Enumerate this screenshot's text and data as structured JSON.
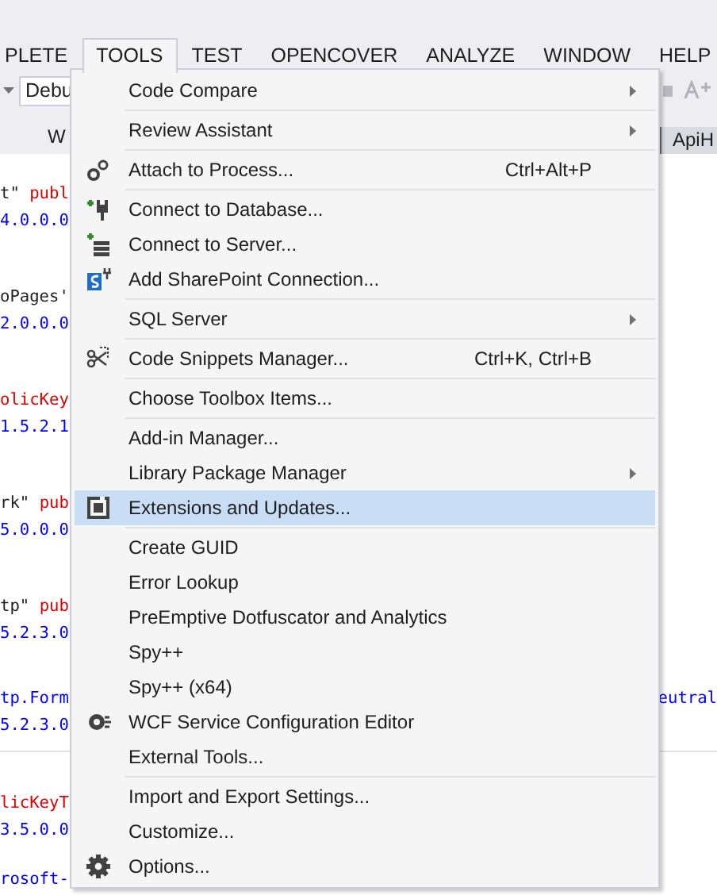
{
  "menu_bar": [
    {
      "label": "PLETE",
      "selected": false
    },
    {
      "label": "TOOLS",
      "selected": true
    },
    {
      "label": "TEST",
      "selected": false
    },
    {
      "label": "OPENCOVER",
      "selected": false
    },
    {
      "label": "ANALYZE",
      "selected": false
    },
    {
      "label": "WINDOW",
      "selected": false
    },
    {
      "label": "HELP",
      "selected": false
    }
  ],
  "toolbar": {
    "config_dropdown": "Debu"
  },
  "tabs": [
    {
      "label": "W",
      "selected": false
    },
    {
      "label": "ApiH",
      "selected": true
    }
  ],
  "code": [
    [
      [
        {
          "text": "t\" ",
          "kind": "plain"
        },
        {
          "text": "publ",
          "kind": "attr"
        }
      ],
      [
        {
          "text": "4.0.0.0",
          "kind": "value"
        }
      ]
    ],
    [
      [
        {
          "text": "oPages'",
          "kind": "plain"
        }
      ],
      [
        {
          "text": "2.0.0.0",
          "kind": "value"
        }
      ]
    ],
    [
      [
        {
          "text": "olicKey",
          "kind": "attr"
        }
      ],
      [
        {
          "text": "1.5.2.1",
          "kind": "value"
        }
      ]
    ],
    [
      [
        {
          "text": "rk\" ",
          "kind": "plain"
        },
        {
          "text": "pub",
          "kind": "attr"
        }
      ],
      [
        {
          "text": "5.0.0.0",
          "kind": "value"
        }
      ]
    ],
    [
      [
        {
          "text": "tp\" ",
          "kind": "plain"
        },
        {
          "text": "pub",
          "kind": "attr"
        }
      ],
      [
        {
          "text": "5.2.3.0",
          "kind": "value"
        }
      ]
    ],
    [
      [
        {
          "text": "tp.Form",
          "kind": "value"
        },
        {
          "text": "eutral",
          "kind": "value_right"
        }
      ],
      [
        {
          "text": "5.2.3.0",
          "kind": "value"
        }
      ]
    ],
    [
      [
        {
          "text": "licKeyT",
          "kind": "attr"
        }
      ],
      [
        {
          "text": "3.5.0.0",
          "kind": "value"
        }
      ]
    ],
    [
      [
        {
          "text": "rosoft-",
          "kind": "value"
        }
      ]
    ]
  ],
  "tools_menu": [
    [
      {
        "label": "Code Compare",
        "submenu": true,
        "selected": false
      }
    ],
    [
      {
        "label": "Review Assistant",
        "submenu": true,
        "selected": false
      }
    ],
    [
      {
        "label": "Attach to Process...",
        "shortcut": "Ctrl+Alt+P",
        "submenu": false,
        "selected": false
      }
    ],
    [
      {
        "label": "Connect to Database...",
        "submenu": false,
        "selected": false
      },
      {
        "label": "Connect to Server...",
        "submenu": false,
        "selected": false
      },
      {
        "label": "Add SharePoint Connection...",
        "submenu": false,
        "selected": false
      }
    ],
    [
      {
        "label": "SQL Server",
        "submenu": true,
        "selected": false
      }
    ],
    [
      {
        "label": "Code Snippets Manager...",
        "shortcut": "Ctrl+K, Ctrl+B",
        "submenu": false,
        "selected": false
      }
    ],
    [
      {
        "label": "Choose Toolbox Items...",
        "submenu": false,
        "selected": false
      }
    ],
    [
      {
        "label": "Add-in Manager...",
        "submenu": false,
        "selected": false
      },
      {
        "label": "Library Package Manager",
        "submenu": true,
        "selected": false
      },
      {
        "label": "Extensions and Updates...",
        "submenu": false,
        "selected": true
      }
    ],
    [
      {
        "label": "Create GUID",
        "submenu": false,
        "selected": false
      },
      {
        "label": "Error Lookup",
        "submenu": false,
        "selected": false
      },
      {
        "label": "PreEmptive Dotfuscator and Analytics",
        "submenu": false,
        "selected": false
      },
      {
        "label": "Spy++",
        "submenu": false,
        "selected": false
      },
      {
        "label": "Spy++ (x64)",
        "submenu": false,
        "selected": false
      },
      {
        "label": "WCF Service Configuration Editor",
        "submenu": false,
        "selected": false
      },
      {
        "label": "External Tools...",
        "submenu": false,
        "selected": false
      }
    ],
    [
      {
        "label": "Import and Export Settings...",
        "submenu": false,
        "selected": false
      },
      {
        "label": "Customize...",
        "submenu": false,
        "selected": false
      },
      {
        "label": "Options...",
        "submenu": false,
        "selected": false
      }
    ]
  ]
}
